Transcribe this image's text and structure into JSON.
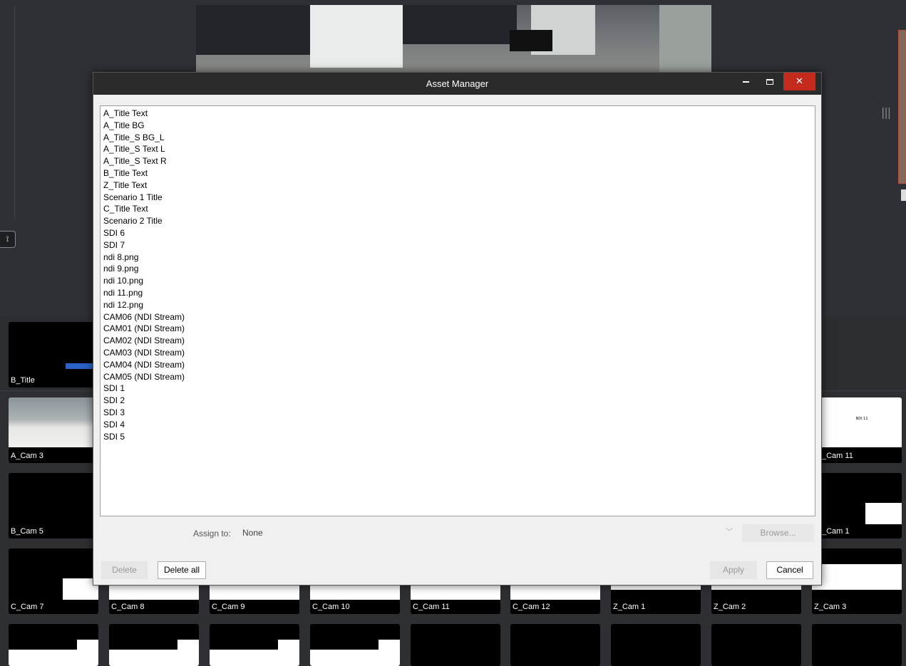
{
  "dialog": {
    "title": "Asset Manager",
    "assets": [
      "A_Title Text",
      "A_Title BG",
      "A_Title_S BG_L",
      "A_Title_S Text L",
      "A_Title_S Text R",
      "B_Title Text",
      "Z_Title Text",
      "Scenario 1 Title",
      "C_Title Text",
      "Scenario 2 Title",
      "SDI 6",
      "SDI 7",
      "ndi 8.png",
      "ndi 9.png",
      "ndi 10.png",
      "ndi 11.png",
      "ndi 12.png",
      "CAM06 (NDI Stream)",
      "CAM01 (NDI Stream)",
      "CAM02 (NDI Stream)",
      "CAM03 (NDI Stream)",
      "CAM04 (NDI Stream)",
      "CAM05 (NDI Stream)",
      "SDI 1",
      "SDI 2",
      "SDI 3",
      "SDI 4",
      "SDI 5"
    ],
    "assign_label": "Assign to:",
    "assign_value": "None",
    "browse_label": "Browse...",
    "delete_label": "Delete",
    "delete_all_label": "Delete all",
    "apply_label": "Apply",
    "cancel_label": "Cancel"
  },
  "background": {
    "tiles": {
      "b_title": "B_Title",
      "a_cam3": "A_Cam 3",
      "cam11_right": "_Cam 11",
      "b_cam5": "B_Cam 5",
      "cam1_right": "_Cam 1",
      "c_cam7": "C_Cam 7",
      "c_cam8": "C_Cam 8",
      "c_cam9": "C_Cam 9",
      "c_cam10": "C_Cam 10",
      "c_cam11": "C_Cam 11",
      "c_cam12": "C_Cam 12",
      "z_cam1": "Z_Cam 1",
      "z_cam2": "Z_Cam 2",
      "z_cam3": "Z_Cam 3"
    },
    "ndi_tile_text": "NDI 11"
  },
  "colors": {
    "close_button": "#c42b1c",
    "title_bar": "#2b2b2b",
    "tile_blue": "#2a62c8"
  }
}
